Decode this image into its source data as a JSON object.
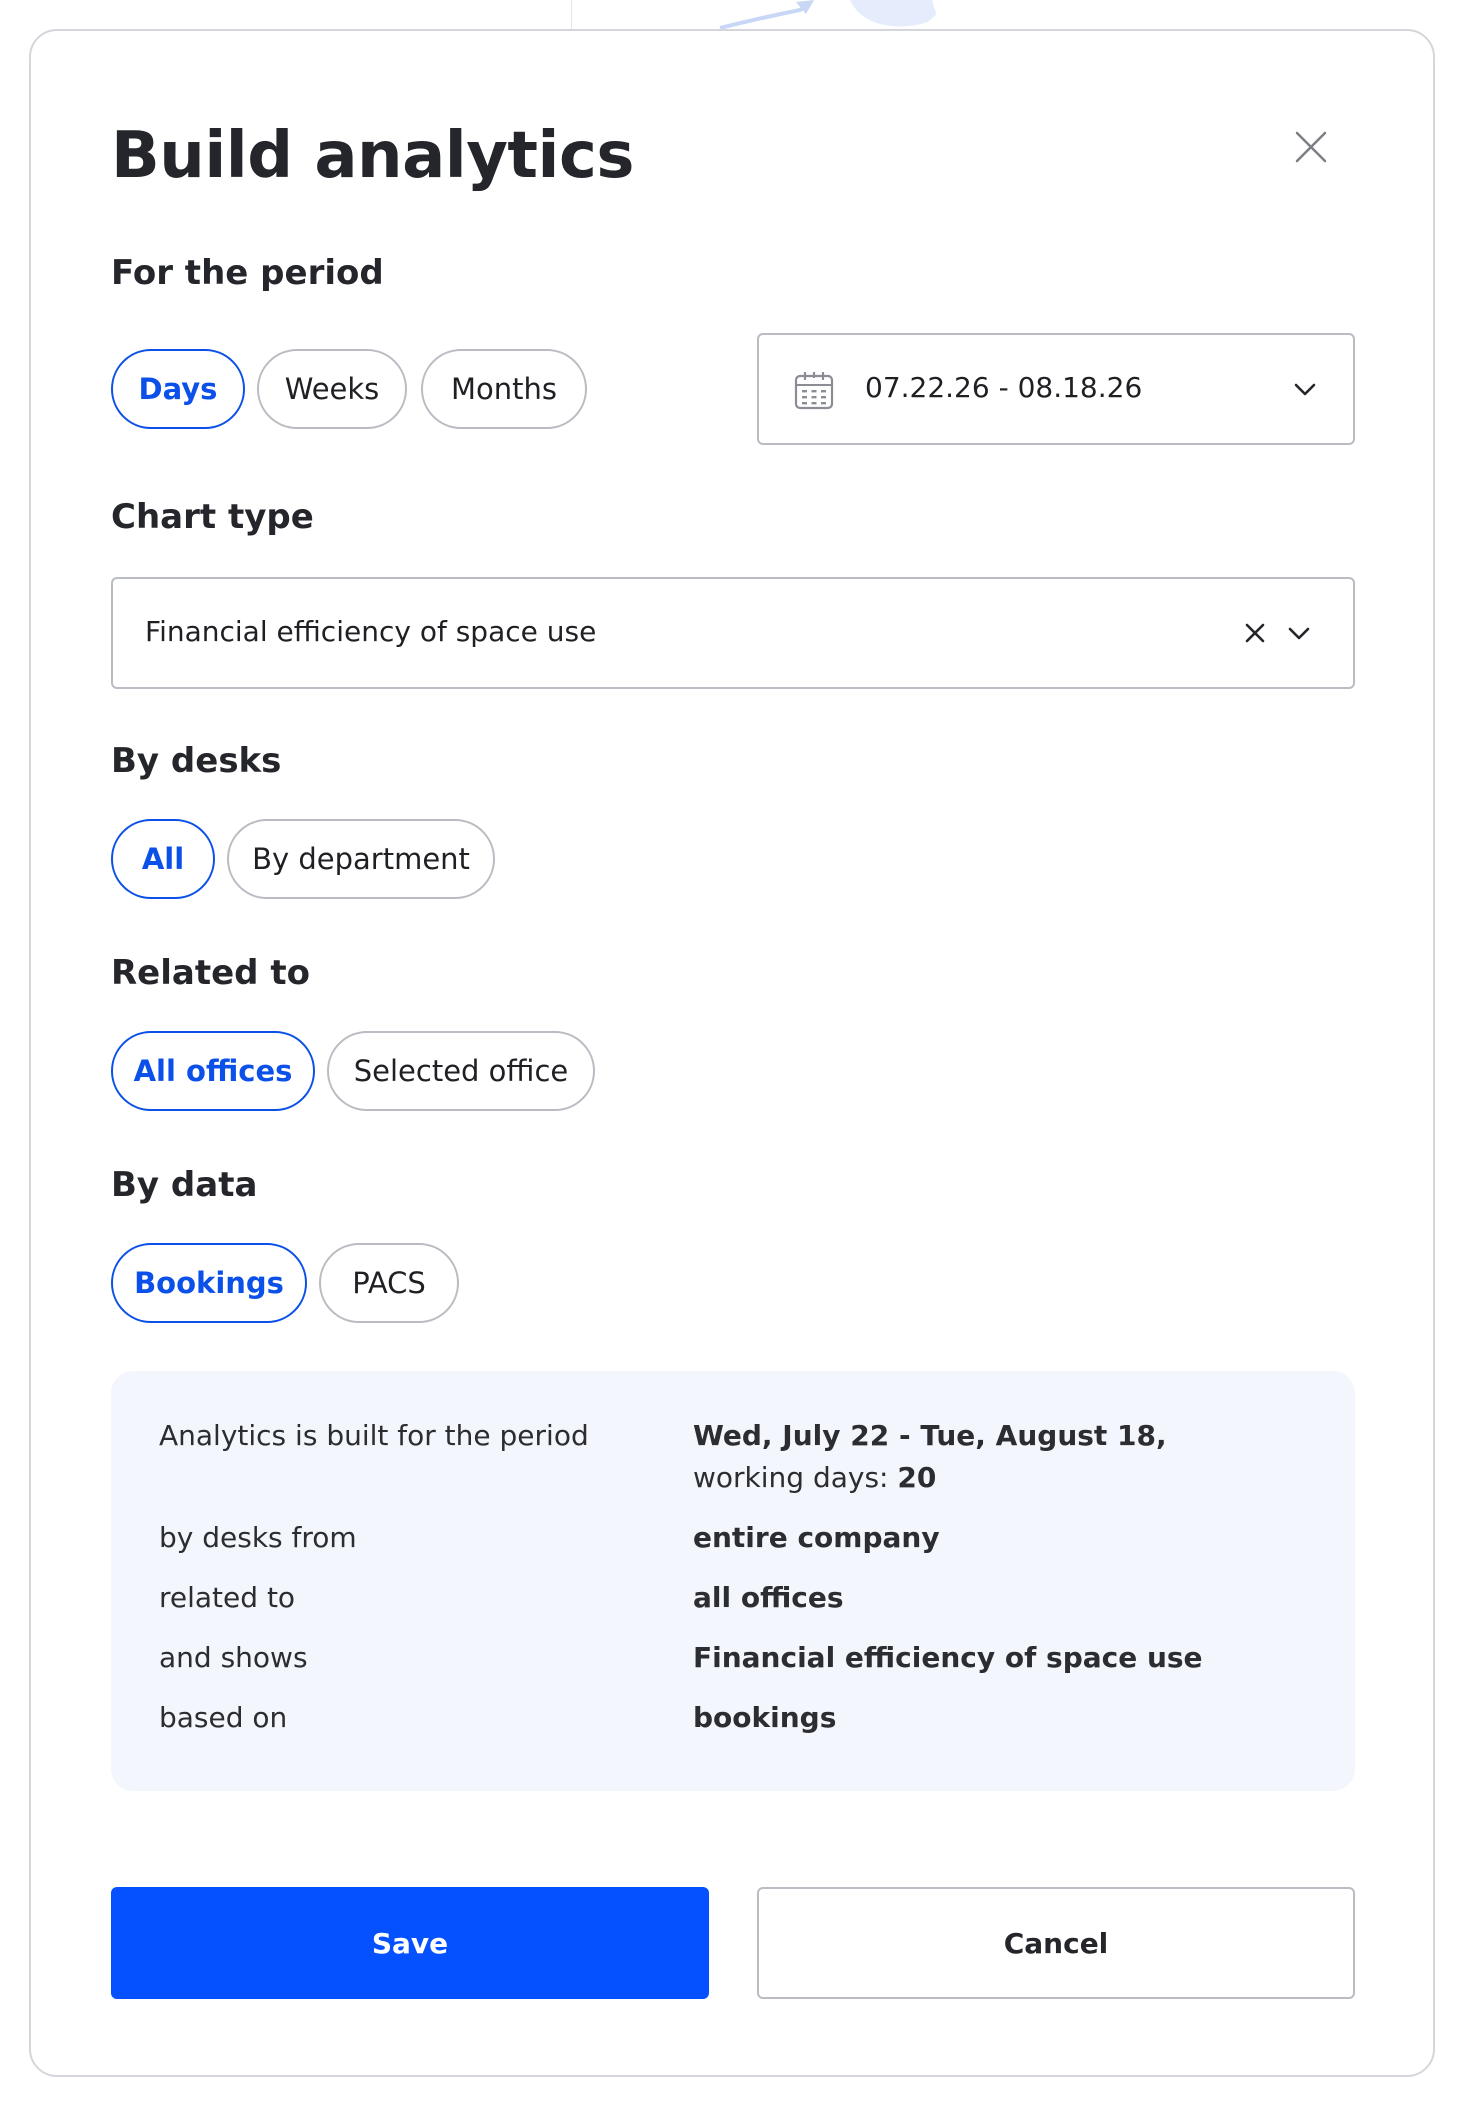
{
  "modal": {
    "title": "Build analytics"
  },
  "period": {
    "section_title": "For the period",
    "options": [
      "Days",
      "Weeks",
      "Months"
    ],
    "selected": "Days",
    "date_range": "07.22.26 - 08.18.26"
  },
  "chart_type": {
    "section_title": "Chart type",
    "value": "Financial efficiency of space use"
  },
  "by_desks": {
    "section_title": "By desks",
    "options": [
      "All",
      "By department"
    ],
    "selected": "All"
  },
  "related_to": {
    "section_title": "Related to",
    "options": [
      "All offices",
      "Selected office"
    ],
    "selected": "All offices"
  },
  "by_data": {
    "section_title": "By data",
    "options": [
      "Bookings",
      "PACS"
    ],
    "selected": "Bookings"
  },
  "summary": {
    "rows": [
      {
        "label": "Analytics is built for the period",
        "value": "Wed, July 22 - Tue, August 18,",
        "sub_label": "working days: ",
        "sub_value": "20"
      },
      {
        "label": "by desks from",
        "value": "entire company"
      },
      {
        "label": "related to",
        "value": "all offices"
      },
      {
        "label": "and shows",
        "value": "Financial efficiency of space use"
      },
      {
        "label": "based on",
        "value": "bookings"
      }
    ]
  },
  "actions": {
    "save_label": "Save",
    "cancel_label": "Cancel"
  },
  "icons": {
    "close": "close-icon",
    "calendar": "calendar-icon",
    "chevron": "chevron-down-icon",
    "clear": "clear-icon"
  },
  "colors": {
    "accent": "#0b50e8",
    "primary_button": "#0550ff",
    "summary_bg": "#f3f6fc",
    "border": "#b9bcc2"
  }
}
